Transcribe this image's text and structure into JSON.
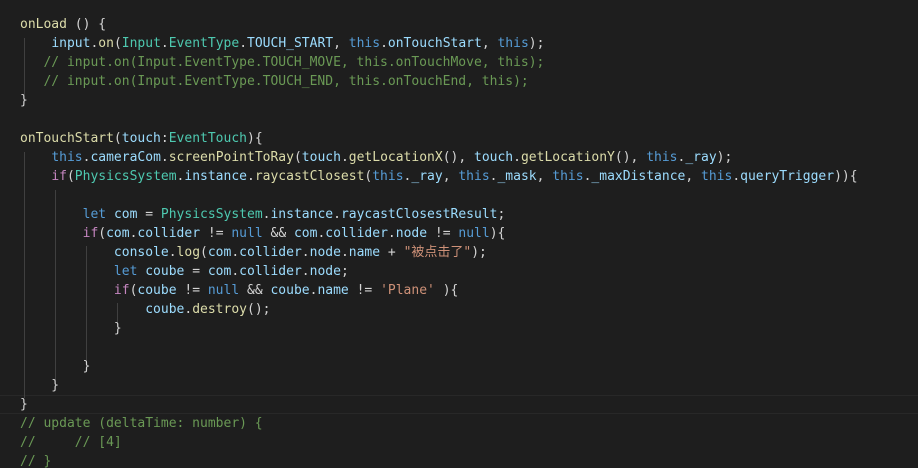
{
  "editor": {
    "lines": [
      [
        {
          "t": "onLoad",
          "c": "fn"
        },
        {
          "t": " () {",
          "c": "pl"
        }
      ],
      [
        {
          "t": "    ",
          "c": "pl"
        },
        {
          "t": "input",
          "c": "var"
        },
        {
          "t": ".",
          "c": "pl"
        },
        {
          "t": "on",
          "c": "fn"
        },
        {
          "t": "(",
          "c": "pl"
        },
        {
          "t": "Input",
          "c": "ty"
        },
        {
          "t": ".",
          "c": "pl"
        },
        {
          "t": "EventType",
          "c": "ty"
        },
        {
          "t": ".",
          "c": "pl"
        },
        {
          "t": "TOUCH_START",
          "c": "var"
        },
        {
          "t": ", ",
          "c": "pl"
        },
        {
          "t": "this",
          "c": "kw"
        },
        {
          "t": ".",
          "c": "pl"
        },
        {
          "t": "onTouchStart",
          "c": "var"
        },
        {
          "t": ", ",
          "c": "pl"
        },
        {
          "t": "this",
          "c": "kw"
        },
        {
          "t": ");",
          "c": "pl"
        }
      ],
      [
        {
          "t": "   // input.on(Input.EventType.TOUCH_MOVE, this.onTouchMove, this);",
          "c": "cm"
        }
      ],
      [
        {
          "t": "   // input.on(Input.EventType.TOUCH_END, this.onTouchEnd, this);",
          "c": "cm"
        }
      ],
      [
        {
          "t": "}",
          "c": "pl"
        }
      ],
      [],
      [
        {
          "t": "onTouchStart",
          "c": "fn"
        },
        {
          "t": "(",
          "c": "pl"
        },
        {
          "t": "touch",
          "c": "var"
        },
        {
          "t": ":",
          "c": "pl"
        },
        {
          "t": "EventTouch",
          "c": "ty"
        },
        {
          "t": "){",
          "c": "pl"
        }
      ],
      [
        {
          "t": "    ",
          "c": "pl"
        },
        {
          "t": "this",
          "c": "kw"
        },
        {
          "t": ".",
          "c": "pl"
        },
        {
          "t": "cameraCom",
          "c": "var"
        },
        {
          "t": ".",
          "c": "pl"
        },
        {
          "t": "screenPointToRay",
          "c": "fn"
        },
        {
          "t": "(",
          "c": "pl"
        },
        {
          "t": "touch",
          "c": "var"
        },
        {
          "t": ".",
          "c": "pl"
        },
        {
          "t": "getLocationX",
          "c": "fn"
        },
        {
          "t": "(), ",
          "c": "pl"
        },
        {
          "t": "touch",
          "c": "var"
        },
        {
          "t": ".",
          "c": "pl"
        },
        {
          "t": "getLocationY",
          "c": "fn"
        },
        {
          "t": "(), ",
          "c": "pl"
        },
        {
          "t": "this",
          "c": "kw"
        },
        {
          "t": ".",
          "c": "pl"
        },
        {
          "t": "_ray",
          "c": "var"
        },
        {
          "t": ");",
          "c": "pl"
        }
      ],
      [
        {
          "t": "    ",
          "c": "pl"
        },
        {
          "t": "if",
          "c": "ctrl"
        },
        {
          "t": "(",
          "c": "pl"
        },
        {
          "t": "PhysicsSystem",
          "c": "ty"
        },
        {
          "t": ".",
          "c": "pl"
        },
        {
          "t": "instance",
          "c": "var"
        },
        {
          "t": ".",
          "c": "pl"
        },
        {
          "t": "raycastClosest",
          "c": "fn"
        },
        {
          "t": "(",
          "c": "pl"
        },
        {
          "t": "this",
          "c": "kw"
        },
        {
          "t": ".",
          "c": "pl"
        },
        {
          "t": "_ray",
          "c": "var"
        },
        {
          "t": ", ",
          "c": "pl"
        },
        {
          "t": "this",
          "c": "kw"
        },
        {
          "t": ".",
          "c": "pl"
        },
        {
          "t": "_mask",
          "c": "var"
        },
        {
          "t": ", ",
          "c": "pl"
        },
        {
          "t": "this",
          "c": "kw"
        },
        {
          "t": ".",
          "c": "pl"
        },
        {
          "t": "_maxDistance",
          "c": "var"
        },
        {
          "t": ", ",
          "c": "pl"
        },
        {
          "t": "this",
          "c": "kw"
        },
        {
          "t": ".",
          "c": "pl"
        },
        {
          "t": "queryTrigger",
          "c": "var"
        },
        {
          "t": ")){",
          "c": "pl"
        }
      ],
      [],
      [
        {
          "t": "        ",
          "c": "pl"
        },
        {
          "t": "let",
          "c": "kw"
        },
        {
          "t": " ",
          "c": "pl"
        },
        {
          "t": "com",
          "c": "var"
        },
        {
          "t": " = ",
          "c": "pl"
        },
        {
          "t": "PhysicsSystem",
          "c": "ty"
        },
        {
          "t": ".",
          "c": "pl"
        },
        {
          "t": "instance",
          "c": "var"
        },
        {
          "t": ".",
          "c": "pl"
        },
        {
          "t": "raycastClosestResult",
          "c": "var"
        },
        {
          "t": ";",
          "c": "pl"
        }
      ],
      [
        {
          "t": "        ",
          "c": "pl"
        },
        {
          "t": "if",
          "c": "ctrl"
        },
        {
          "t": "(",
          "c": "pl"
        },
        {
          "t": "com",
          "c": "var"
        },
        {
          "t": ".",
          "c": "pl"
        },
        {
          "t": "collider",
          "c": "var"
        },
        {
          "t": " != ",
          "c": "pl"
        },
        {
          "t": "null",
          "c": "kw"
        },
        {
          "t": " && ",
          "c": "pl"
        },
        {
          "t": "com",
          "c": "var"
        },
        {
          "t": ".",
          "c": "pl"
        },
        {
          "t": "collider",
          "c": "var"
        },
        {
          "t": ".",
          "c": "pl"
        },
        {
          "t": "node",
          "c": "var"
        },
        {
          "t": " != ",
          "c": "pl"
        },
        {
          "t": "null",
          "c": "kw"
        },
        {
          "t": "){",
          "c": "pl"
        }
      ],
      [
        {
          "t": "            ",
          "c": "pl"
        },
        {
          "t": "console",
          "c": "var"
        },
        {
          "t": ".",
          "c": "pl"
        },
        {
          "t": "log",
          "c": "fn"
        },
        {
          "t": "(",
          "c": "pl"
        },
        {
          "t": "com",
          "c": "var"
        },
        {
          "t": ".",
          "c": "pl"
        },
        {
          "t": "collider",
          "c": "var"
        },
        {
          "t": ".",
          "c": "pl"
        },
        {
          "t": "node",
          "c": "var"
        },
        {
          "t": ".",
          "c": "pl"
        },
        {
          "t": "name",
          "c": "var"
        },
        {
          "t": " + ",
          "c": "pl"
        },
        {
          "t": "\"被点击了\"",
          "c": "str"
        },
        {
          "t": ");",
          "c": "pl"
        }
      ],
      [
        {
          "t": "            ",
          "c": "pl"
        },
        {
          "t": "let",
          "c": "kw"
        },
        {
          "t": " ",
          "c": "pl"
        },
        {
          "t": "coube",
          "c": "var"
        },
        {
          "t": " = ",
          "c": "pl"
        },
        {
          "t": "com",
          "c": "var"
        },
        {
          "t": ".",
          "c": "pl"
        },
        {
          "t": "collider",
          "c": "var"
        },
        {
          "t": ".",
          "c": "pl"
        },
        {
          "t": "node",
          "c": "var"
        },
        {
          "t": ";",
          "c": "pl"
        }
      ],
      [
        {
          "t": "            ",
          "c": "pl"
        },
        {
          "t": "if",
          "c": "ctrl"
        },
        {
          "t": "(",
          "c": "pl"
        },
        {
          "t": "coube",
          "c": "var"
        },
        {
          "t": " != ",
          "c": "pl"
        },
        {
          "t": "null",
          "c": "kw"
        },
        {
          "t": " && ",
          "c": "pl"
        },
        {
          "t": "coube",
          "c": "var"
        },
        {
          "t": ".",
          "c": "pl"
        },
        {
          "t": "name",
          "c": "var"
        },
        {
          "t": " != ",
          "c": "pl"
        },
        {
          "t": "'Plane'",
          "c": "str"
        },
        {
          "t": " ){",
          "c": "pl"
        }
      ],
      [
        {
          "t": "                ",
          "c": "pl"
        },
        {
          "t": "coube",
          "c": "var"
        },
        {
          "t": ".",
          "c": "pl"
        },
        {
          "t": "destroy",
          "c": "fn"
        },
        {
          "t": "();",
          "c": "pl"
        }
      ],
      [
        {
          "t": "            }",
          "c": "pl"
        }
      ],
      [],
      [
        {
          "t": "        }",
          "c": "pl"
        }
      ],
      [
        {
          "t": "    }",
          "c": "pl"
        }
      ],
      [
        {
          "t": "}",
          "c": "pl"
        }
      ],
      [
        {
          "t": "// update (deltaTime: number) {",
          "c": "cm"
        }
      ],
      [
        {
          "t": "//     // [4]",
          "c": "cm"
        }
      ],
      [
        {
          "t": "// }",
          "c": "cm"
        }
      ]
    ]
  }
}
